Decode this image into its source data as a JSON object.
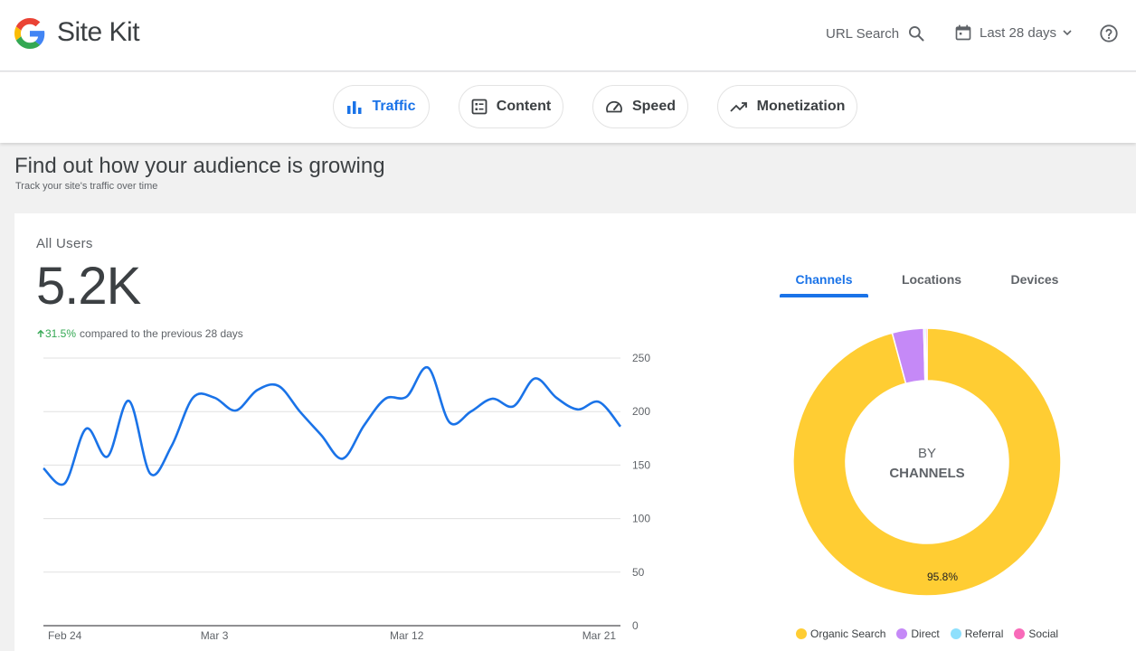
{
  "header": {
    "brand": "Site Kit",
    "url_search_label": "URL Search",
    "date_range_label": "Last 28 days"
  },
  "tabs": [
    {
      "label": "Traffic",
      "icon": "bar-chart-icon",
      "active": true
    },
    {
      "label": "Content",
      "icon": "list-box-icon",
      "active": false
    },
    {
      "label": "Speed",
      "icon": "speedometer-icon",
      "active": false
    },
    {
      "label": "Monetization",
      "icon": "trending-up-icon",
      "active": false
    }
  ],
  "section": {
    "title": "Find out how your audience is growing",
    "subtitle": "Track your site's traffic over time"
  },
  "metric": {
    "label": "All Users",
    "value": "5.2K",
    "change": "31.5%",
    "change_suffix": "compared to the previous 28 days"
  },
  "dimension_tabs": [
    "Channels",
    "Locations",
    "Devices"
  ],
  "donut": {
    "center_line1": "BY",
    "center_line2": "CHANNELS",
    "slice_label": "95.8%"
  },
  "colors": {
    "accent": "#1a73e8",
    "positive": "#34a853",
    "organic": "#ffcd33",
    "direct": "#c589f7",
    "referral": "#8ee0fd",
    "social": "#f86ab9"
  },
  "chart_data": [
    {
      "type": "line",
      "title": "",
      "xlabel": "",
      "ylabel": "",
      "x_ticks": [
        "Feb 24",
        "Mar 3",
        "Mar 12",
        "Mar 21"
      ],
      "y_ticks": [
        "250",
        "200",
        "150",
        "100",
        "50",
        "0"
      ],
      "ylim": [
        0,
        250
      ],
      "grid": true,
      "y_axis_side": "right",
      "series": [
        {
          "values": [
            147,
            133,
            184,
            158,
            210,
            142,
            168,
            213,
            213,
            201,
            220,
            224,
            200,
            178,
            156,
            187,
            212,
            214,
            241,
            190,
            200,
            212,
            205,
            231,
            213,
            202,
            209,
            186
          ]
        }
      ]
    },
    {
      "type": "pie",
      "title": "",
      "legend": "bottom",
      "labels": [
        "Organic Search",
        "Direct",
        "Referral",
        "Social"
      ],
      "values": [
        95.8,
        3.8,
        0.2,
        0.2
      ]
    }
  ]
}
